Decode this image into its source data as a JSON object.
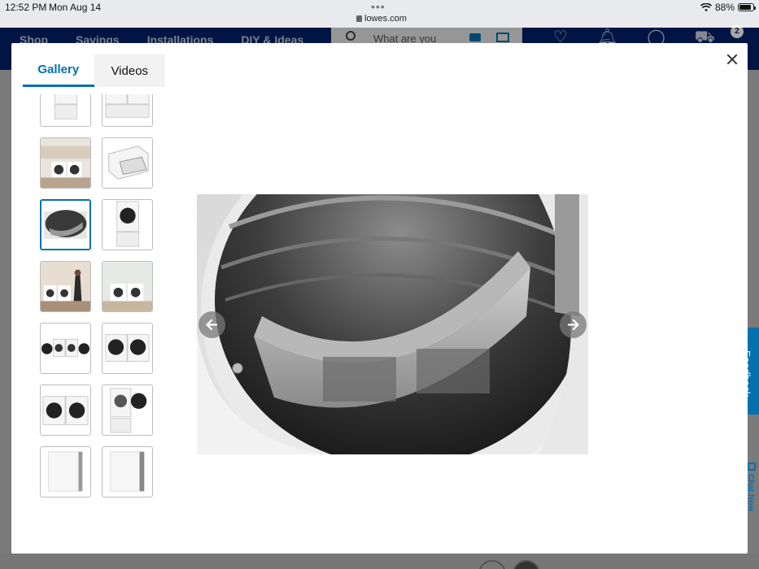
{
  "status_bar": {
    "time": "12:52 PM",
    "date": "Mon Aug 14",
    "url": "lowes.com",
    "battery": "88%",
    "battery_level": 0.88
  },
  "nav": {
    "links": [
      "Shop",
      "Savings",
      "Installations",
      "DIY & Ideas"
    ],
    "search_placeholder": "What are you",
    "cart_count": "2",
    "icons": [
      "heart-icon",
      "bell-icon",
      "account-icon",
      "cart-icon"
    ]
  },
  "gallery": {
    "tabs": [
      {
        "label": "Gallery",
        "active": true
      },
      {
        "label": "Videos",
        "active": false
      }
    ],
    "close_icon": "close-icon",
    "selected_index": 4,
    "thumbnails": [
      {
        "subject": "washer-on-pedestal"
      },
      {
        "subject": "pair-on-pedestals"
      },
      {
        "subject": "laundry-room-scene"
      },
      {
        "subject": "pedestal-drawer"
      },
      {
        "subject": "dryer-drum-interior"
      },
      {
        "subject": "dryer-on-pedestal"
      },
      {
        "subject": "person-laundry-scene"
      },
      {
        "subject": "laundry-room-pair"
      },
      {
        "subject": "pair-doors-open"
      },
      {
        "subject": "pair-front"
      },
      {
        "subject": "pair-front-angle"
      },
      {
        "subject": "stacked-door-open"
      },
      {
        "subject": "side-view"
      },
      {
        "subject": "side-view-alt"
      }
    ],
    "arrow_prev_icon": "arrow-left-icon",
    "arrow_next_icon": "arrow-right-icon"
  },
  "side_tabs": {
    "feedback": "Feedback",
    "chat": "Chat Now"
  },
  "colors": {
    "brand_blue": "#012169",
    "accent_blue": "#0471af"
  }
}
